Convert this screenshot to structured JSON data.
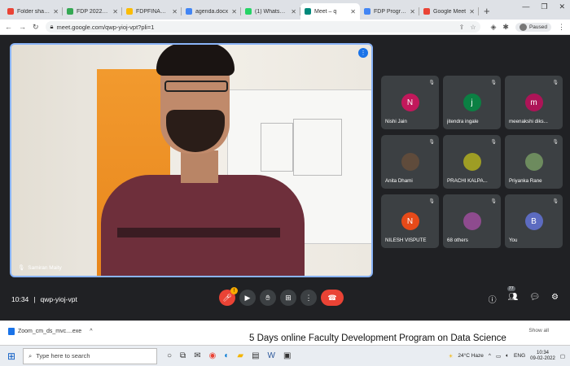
{
  "browser": {
    "tabs": [
      {
        "title": "Folder shared",
        "color": "#ea4335",
        "glyph": "M",
        "active": false
      },
      {
        "title": "FDP 2022 - G",
        "color": "#34a853",
        "glyph": "▲",
        "active": false
      },
      {
        "title": "FDPFINAL Bri",
        "color": "#fbbc04",
        "glyph": "■",
        "active": false
      },
      {
        "title": "agenda.docx",
        "color": "#4285f4",
        "glyph": "■",
        "active": false
      },
      {
        "title": "(1) WhatsApp",
        "color": "#25d366",
        "glyph": "●",
        "active": false
      },
      {
        "title": "Meet – q",
        "color": "#00897b",
        "glyph": "■",
        "active": true
      },
      {
        "title": "FDP Program",
        "color": "#4285f4",
        "glyph": "■",
        "active": false
      },
      {
        "title": "Google Meet",
        "color": "#ea4335",
        "glyph": "■",
        "active": false
      }
    ],
    "new_tab": "+",
    "window_controls": [
      "—",
      "❐",
      "✕"
    ],
    "url": "meet.google.com/qwp-yioj-vpt?pli=1",
    "profile_label": "Paused"
  },
  "meet": {
    "speaker_name": "Samiran Maity",
    "participants": [
      {
        "name": "Nishi Jain",
        "initial": "N",
        "color": "#c2185b"
      },
      {
        "name": "jitendra ingale",
        "initial": "j",
        "color": "#0b8043"
      },
      {
        "name": "meenakshi diks...",
        "initial": "m",
        "color": "#ad1457"
      },
      {
        "name": "Anita Dhami",
        "initial": "",
        "color": "#5f4b3b"
      },
      {
        "name": "PRACHI KALPA...",
        "initial": "",
        "color": "#9e9d24"
      },
      {
        "name": "Priyanka Rane",
        "initial": "",
        "color": "#6d8b5e"
      },
      {
        "name": "NILESH VISPUTE",
        "initial": "N",
        "color": "#e64a19"
      },
      {
        "name": "68 others",
        "initial": "",
        "color": "#8e4b8e"
      },
      {
        "name": "You",
        "initial": "B",
        "color": "#5c6bc0"
      }
    ],
    "time": "10:34",
    "meeting_code": "qwp-yioj-vpt",
    "participant_count": "77"
  },
  "download": {
    "file": "Zoom_cm_ds_mvc....exe",
    "show_all": "Show all"
  },
  "caption": "5 Days online Faculty Development Program on Data Science",
  "taskbar": {
    "search_placeholder": "Type here to search",
    "weather": "24°C  Haze",
    "lang": "ENG",
    "time": "10:34",
    "date": "09-02-2022"
  }
}
